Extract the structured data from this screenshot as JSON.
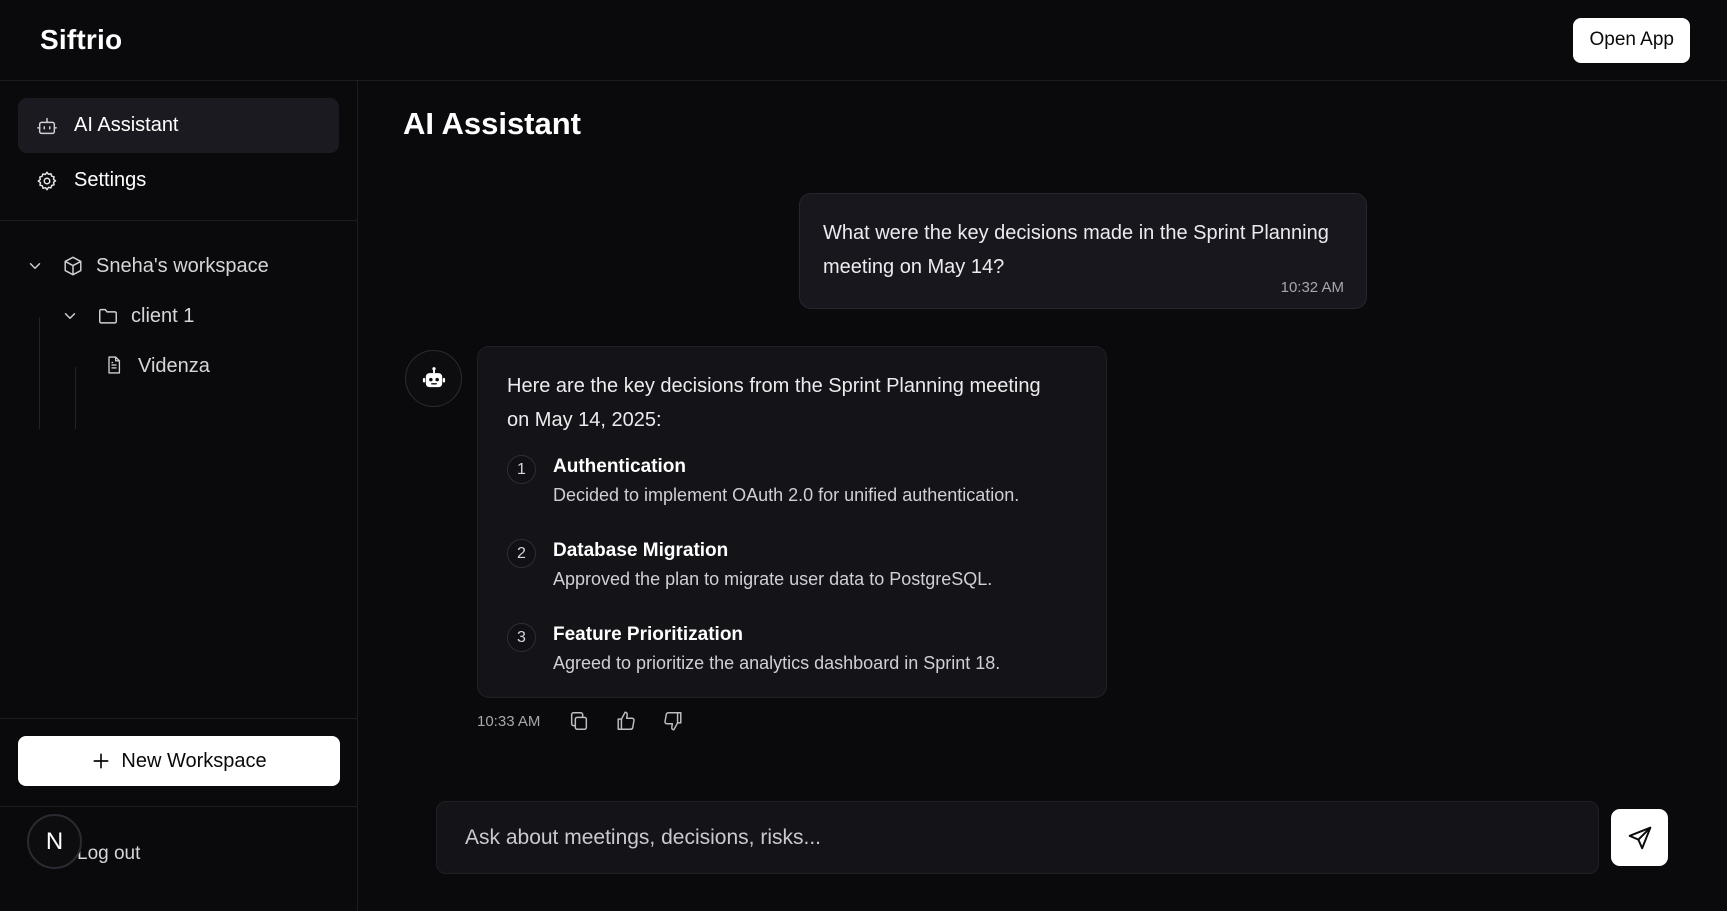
{
  "header": {
    "brand": "Siftrio",
    "open_app_label": "Open App"
  },
  "sidebar": {
    "nav": [
      {
        "label": "AI Assistant",
        "icon": "robot-icon",
        "active": true
      },
      {
        "label": "Settings",
        "icon": "gear-icon",
        "active": false
      }
    ],
    "tree": {
      "workspace": "Sneha's workspace",
      "folder": "client 1",
      "file": "Videnza"
    },
    "new_workspace_label": "New Workspace",
    "logout_label": "Log out",
    "avatar_initial": "N"
  },
  "main": {
    "title": "AI Assistant",
    "user_message": {
      "text": "What were the key decisions made in the Sprint Planning meeting on May 14?",
      "time": "10:32 AM"
    },
    "bot_message": {
      "intro": "Here are the key decisions from the Sprint Planning meeting on May 14, 2025:",
      "decisions": [
        {
          "num": "1",
          "title": "Authentication",
          "desc": "Decided to implement OAuth 2.0 for unified authentication."
        },
        {
          "num": "2",
          "title": "Database Migration",
          "desc": "Approved the plan to migrate user data to PostgreSQL."
        },
        {
          "num": "3",
          "title": "Feature Prioritization",
          "desc": "Agreed to prioritize the analytics dashboard in Sprint 18."
        }
      ],
      "time": "10:33 AM"
    },
    "composer": {
      "placeholder": "Ask about meetings, decisions, risks..."
    }
  },
  "colors": {
    "background": "#0a0a0c",
    "panel": "#141418",
    "accent_button": "#ffffff"
  }
}
